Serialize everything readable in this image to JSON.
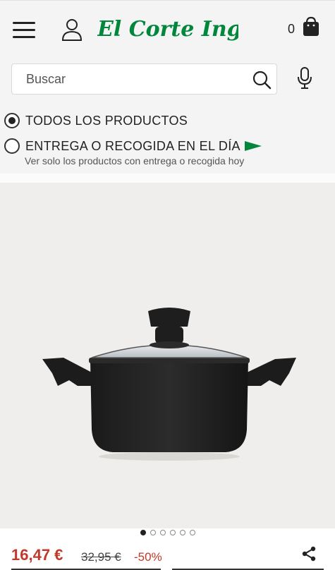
{
  "header": {
    "brand": "El Corte Inglés",
    "cart_count": "0",
    "brand_color": "#00873c"
  },
  "search": {
    "placeholder": "Buscar"
  },
  "filters": {
    "options": [
      {
        "label": "TODOS LOS PRODUCTOS",
        "checked": true
      },
      {
        "label": "ENTREGA O RECOGIDA EN EL DÍA",
        "checked": false,
        "sublabel": "Ver solo los productos con entrega o recogida hoy"
      }
    ]
  },
  "gallery": {
    "image_count": 6,
    "active_index": 0
  },
  "price": {
    "current": "16,47 €",
    "original": "32,95 €",
    "discount": "-50%",
    "accent_color": "#c0392b"
  }
}
